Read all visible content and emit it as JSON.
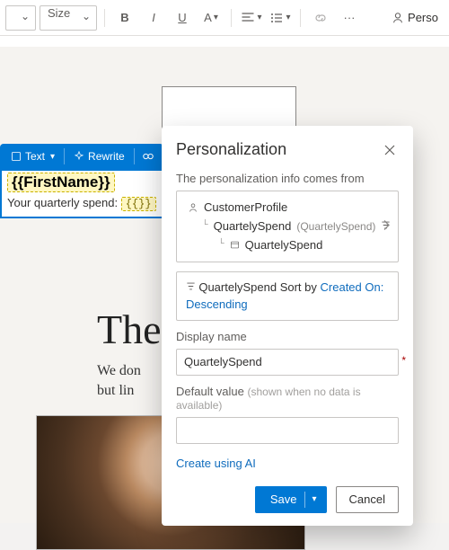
{
  "toolbar": {
    "font_dropdown": "",
    "size_label": "Size",
    "perso_label": "Perso"
  },
  "mini_toolbar": {
    "text_label": "Text",
    "rewrite_label": "Rewrite"
  },
  "content": {
    "token_firstname": "{{FirstName}}",
    "spend_prefix": "Your quarterly spend: ",
    "token_empty": "{{}}"
  },
  "background": {
    "heading_fragment": "The",
    "para_line1": "We don",
    "para_line2": "but lin"
  },
  "panel": {
    "title": "Personalization",
    "source_label": "The personalization info comes from",
    "path": {
      "root": "CustomerProfile",
      "child": "QuartelySpend",
      "child_suffix": "(QuartelySpend)",
      "grandchild": "QuartelySpend"
    },
    "sort": {
      "field": "QuartelySpend",
      "sort_word": "Sort by",
      "sort_link": "Created On: Descending"
    },
    "display_name_label": "Display name",
    "display_name_value": "QuartelySpend",
    "default_label": "Default value",
    "default_hint": "(shown when no data is available)",
    "default_value": "",
    "create_ai": "Create using AI",
    "save": "Save",
    "cancel": "Cancel"
  }
}
